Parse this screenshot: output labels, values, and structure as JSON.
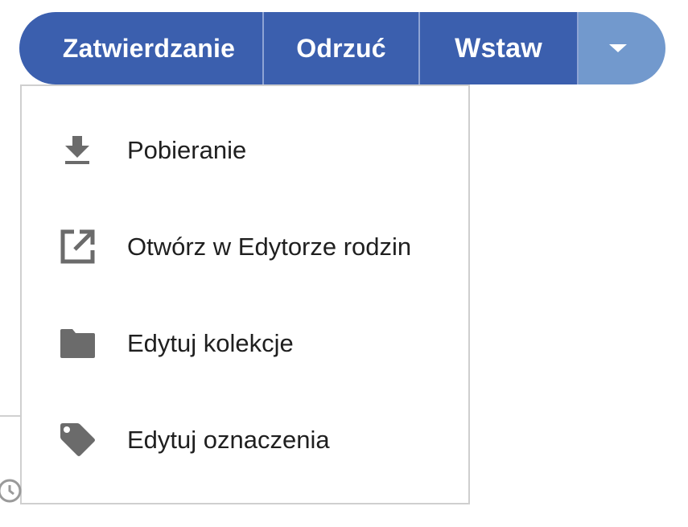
{
  "toolbar": {
    "approve_label": "Zatwierdzanie",
    "reject_label": "Odrzuć",
    "insert_label": "Wstaw",
    "toggle_icon": "caret-down-icon",
    "colors": {
      "primary": "#3b5fae",
      "toggle": "#7299cd",
      "text": "#ffffff"
    }
  },
  "menu": {
    "items": [
      {
        "label": "Pobieranie",
        "icon": "download-icon"
      },
      {
        "label": "Otwórz w Edytorze rodzin",
        "icon": "open-external-icon"
      },
      {
        "label": "Edytuj kolekcje",
        "icon": "folder-icon"
      },
      {
        "label": "Edytuj oznaczenia",
        "icon": "tag-icon"
      }
    ],
    "icon_color": "#6b6b6b"
  }
}
